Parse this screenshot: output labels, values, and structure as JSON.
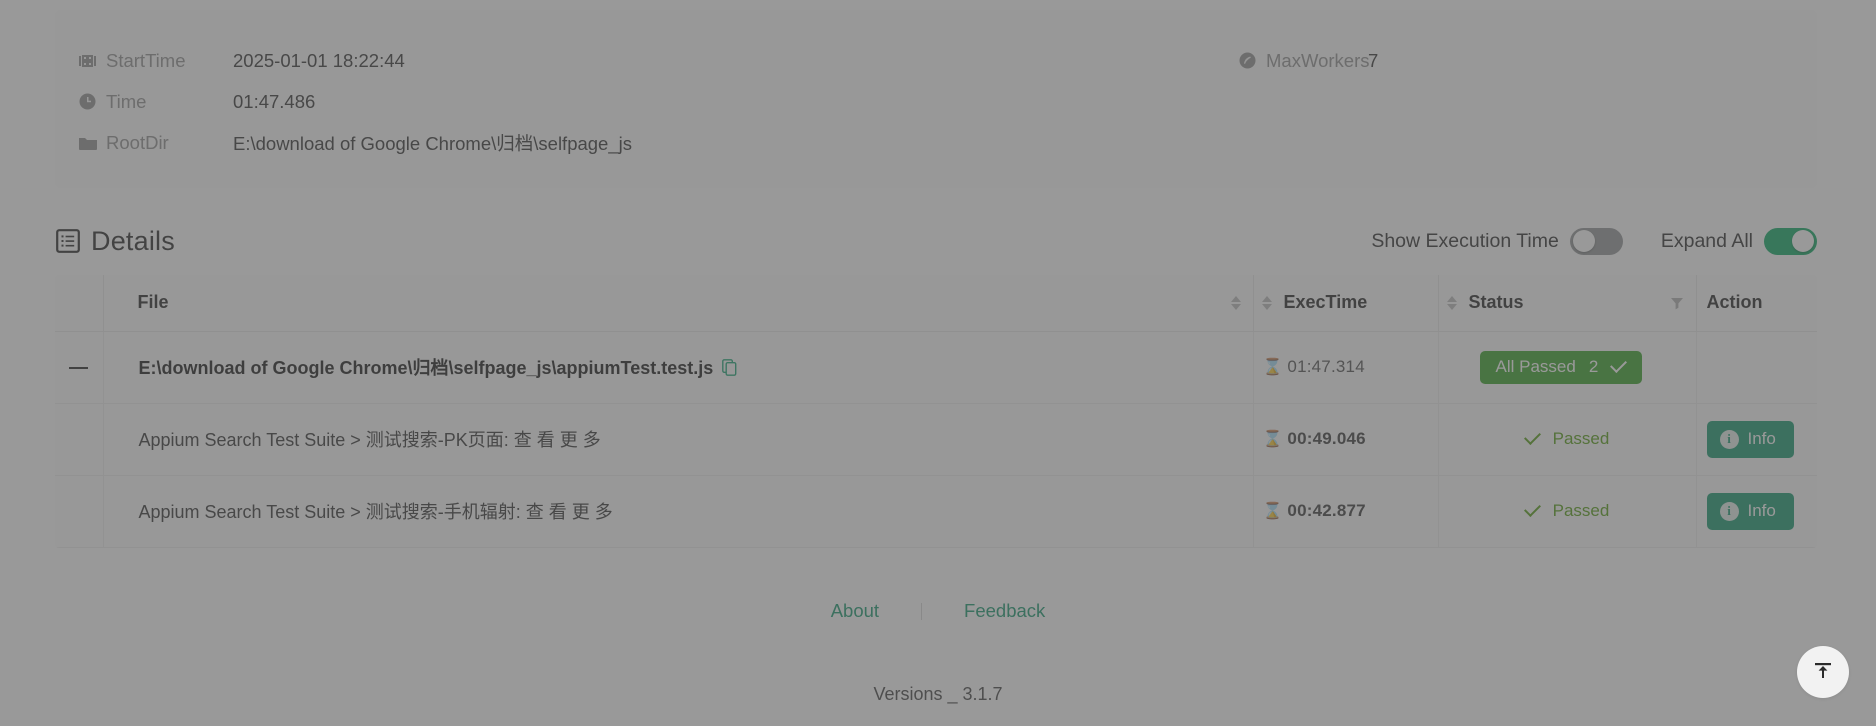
{
  "summary": {
    "left_rows": [
      {
        "icon": "film-icon",
        "label": "StartTime",
        "value": "2025-01-01 18:22:44"
      },
      {
        "icon": "clock-icon",
        "label": "Time",
        "value": "01:47.486"
      },
      {
        "icon": "folder-icon",
        "label": "RootDir",
        "value": "E:\\download of Google Chrome\\归档\\selfpage_js"
      }
    ],
    "right_rows": [
      {
        "icon": "rocket-icon",
        "label": "MaxWorkers",
        "value": "7"
      }
    ]
  },
  "details": {
    "title": "Details",
    "title_icon": "list-box-icon",
    "controls": {
      "show_execution_time_label": "Show Execution Time",
      "show_execution_time_on": false,
      "expand_all_label": "Expand All",
      "expand_all_on": true
    },
    "columns": [
      {
        "key": "expand",
        "label": ""
      },
      {
        "key": "file",
        "label": "File",
        "sortable": true
      },
      {
        "key": "exec",
        "label": "ExecTime",
        "sortable": true
      },
      {
        "key": "status",
        "label": "Status",
        "filterable": true
      },
      {
        "key": "action",
        "label": "Action"
      }
    ],
    "rows": [
      {
        "type": "file",
        "expand_icon": "minus-icon",
        "file": "E:\\download of Google Chrome\\归档\\selfpage_js\\appiumTest.test.js",
        "copy_icon": "copy-icon",
        "exec_time": "01:47.314",
        "status_badge": {
          "label": "All Passed",
          "count": "2",
          "icon": "check-icon"
        }
      },
      {
        "type": "case",
        "name": "Appium Search Test Suite > 测试搜索-PK页面: 查 看 更 多",
        "exec_time": "00:49.046",
        "status": "Passed",
        "action_label": "Info"
      },
      {
        "type": "case",
        "name": "Appium Search Test Suite > 测试搜索-手机辐射: 查 看 更 多",
        "exec_time": "00:42.877",
        "status": "Passed",
        "action_label": "Info"
      }
    ]
  },
  "footer": {
    "about_label": "About",
    "feedback_label": "Feedback",
    "version": "Versions _ 3.1.7"
  },
  "back_to_top": {
    "icon": "arrow-to-top-icon"
  },
  "colors": {
    "accent_green": "#0d9367",
    "badge_green": "#2f9e1e",
    "passed_green": "#4e9a0a",
    "toggle_on": "#00a65c",
    "toggle_off": "#8f9294"
  }
}
